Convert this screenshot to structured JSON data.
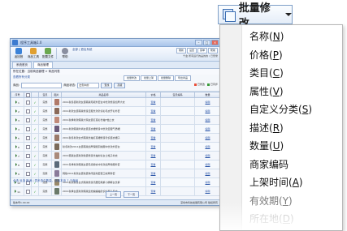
{
  "app": {
    "title": "程序工具箱1.0",
    "toolbar": [
      {
        "label": "返回首",
        "color": "#3a82d8"
      },
      {
        "label": "商品工具",
        "color": "#e0a030"
      },
      {
        "label": "配置文件",
        "color": "#6aa84f"
      },
      {
        "label": "帮助",
        "color": "#8a8fa0"
      }
    ],
    "top_links": "全部 | 退出系统",
    "top_buttons": [
      "刷新",
      "设置",
      "菜单",
      "帮助"
    ],
    "shop_info": "千金 所有运行的是的的 / 已登录",
    "tabs": [
      "系统首页",
      "商品管理"
    ],
    "breadcrumb": "所在位置：当前商品管理 > 商品列表",
    "category_link": "查看所有分类",
    "op_buttons": [
      "批量修改",
      "批量上架",
      "批量删除",
      "导出商品"
    ],
    "filter": {
      "keyword_label": "商品:",
      "status_label": "商品状态:",
      "status_value": "出售中的",
      "search_label": "查找",
      "advanced_label": "高级"
    },
    "legend": [
      {
        "label": "已修改",
        "color": "#e94f3a"
      },
      {
        "label": "已同步",
        "color": "#3b9c3b"
      }
    ],
    "columns": [
      "序号",
      "",
      "",
      "宝贝",
      "图片",
      "商品名称",
      "价格",
      "宝贝编码",
      "数量"
    ],
    "rows": [
      {
        "n": "1",
        "status": "完整",
        "title": "2011秋冬装新款女装韩版毛呢外套女中长款修身加厚大衣",
        "price": "查看",
        "op": "编辑",
        "thumb": "#b07a6a"
      },
      {
        "n": "2",
        "status": "完整",
        "title": "2011新款女装韩版修身显瘦长款针织衫毛衣开衫外套",
        "price": "查看",
        "op": "编辑",
        "thumb": "#8a6a5a"
      },
      {
        "n": "3",
        "status": "完整",
        "title": "2011秋季新款韩版大码女装打底衫长袖T恤上衣",
        "price": "查看",
        "op": "编辑",
        "thumb": "#c08a7a"
      },
      {
        "n": "4",
        "status": "完整",
        "title": "2011新款韩版时尚女装连衣裙修身中长款显瘦气质裙",
        "price": "查看",
        "op": "编辑",
        "thumb": "#6a5a7a"
      },
      {
        "n": "5",
        "status": "完整",
        "title": "2011秋冬新款女式韩版长袖打底裙修身针织连衣裙子",
        "price": "查看",
        "op": "编辑",
        "thumb": "#9a7a6a"
      },
      {
        "n": "6",
        "status": "完整",
        "title": "秋冬新款2011女装韩版加厚保暖羽绒服中长款外套女",
        "price": "查看",
        "op": "编辑",
        "thumb": "#7a6a5a"
      },
      {
        "n": "7",
        "status": "完整",
        "title": "2011韩版女装新款秋装修身长袖衬衫女士格子衬衣",
        "price": "查看",
        "op": "编辑",
        "thumb": "#aa8a7a"
      },
      {
        "n": "8",
        "status": "完整",
        "title": "2011冬季新款韩版女装毛领棉衣中长款加厚棉服外套",
        "price": "查看",
        "op": "编辑",
        "thumb": "#5a6a7a"
      },
      {
        "n": "9",
        "status": "完整",
        "title": "韩版2011新款女装秋装休闲运动套装卫衣两件套",
        "price": "查看",
        "op": "编辑",
        "thumb": "#8a7a9a"
      },
      {
        "n": "10",
        "status": "完整",
        "title": "2011新款秋冬女式韩版修身高腰铅笔裤小脚裤女长裤",
        "price": "查看",
        "op": "编辑",
        "thumb": "#9a8a6a"
      },
      {
        "n": "11",
        "status": "完整",
        "title": "2011秋季女装新款韩版宽松蝙蝠袖针织衫套头毛衣",
        "price": "查看",
        "op": "编辑",
        "thumb": "#6a7a6a"
      }
    ],
    "bottom_links": "全选  反选  取消 | 同步选中数量，选取本页 7 个商品",
    "pager": [
      "上一页",
      "下一页"
    ],
    "status_left": "版本号1.00.00",
    "status_right": "深圳市科技发展有限公司 版权所有"
  },
  "dropdown": {
    "button_label": "批量修改",
    "items": [
      {
        "text": "名称",
        "key": "N"
      },
      {
        "text": "价格",
        "key": "P"
      },
      {
        "text": "类目",
        "key": "C"
      },
      {
        "text": "属性",
        "key": "V"
      },
      {
        "text": "自定义分类",
        "key": "S"
      },
      {
        "text": "描述",
        "key": "R"
      },
      {
        "text": "数量",
        "key": "U"
      },
      {
        "text": "商家编码",
        "key": ""
      },
      {
        "text": "上架时间",
        "key": "A"
      },
      {
        "text": "有效期",
        "key": "Y"
      },
      {
        "text": "所在地",
        "key": "D"
      }
    ]
  }
}
